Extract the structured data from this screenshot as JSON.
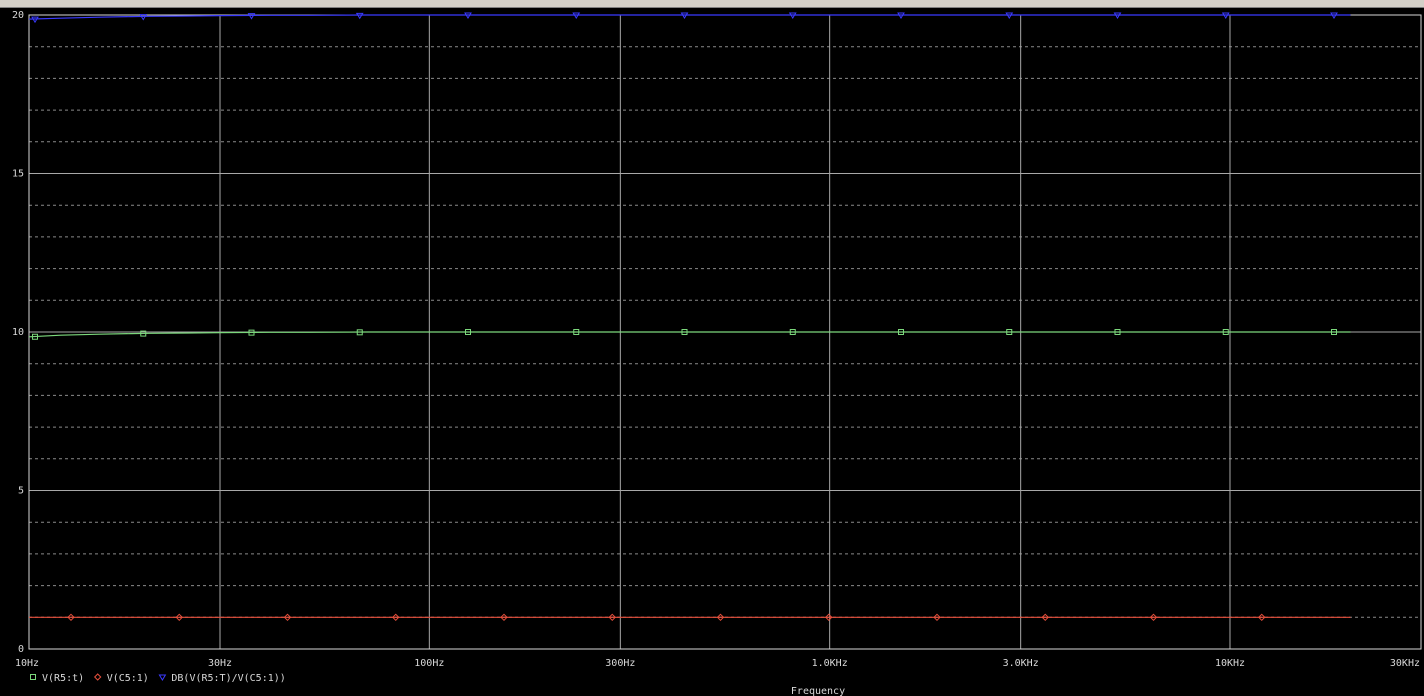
{
  "chart_data": {
    "type": "line",
    "xscale": "log",
    "xlim": [
      "10Hz",
      "30KHz"
    ],
    "ylim": [
      0,
      20
    ],
    "grid": true,
    "legend_position": "bottom-left",
    "xlabel": "Frequency",
    "ylabel": "",
    "title": "",
    "x_ticks": [
      "10Hz",
      "30Hz",
      "100Hz",
      "300Hz",
      "1.0KHz",
      "3.0KHz",
      "10KHz",
      "30KHz"
    ],
    "y_ticks": [
      "0",
      "5",
      "10",
      "15",
      "20"
    ],
    "x_values_hz": [
      10,
      12,
      15,
      18,
      20,
      25,
      30,
      40,
      50,
      70,
      100,
      150,
      200,
      300,
      500,
      700,
      1000,
      1500,
      2000,
      3000,
      5000,
      7000,
      10000,
      15000,
      20000
    ],
    "series": [
      {
        "name": "V(R5:t)",
        "color": "#7cd87c",
        "marker": "square",
        "values": [
          9.85,
          9.9,
          9.93,
          9.95,
          9.96,
          9.97,
          9.98,
          9.99,
          9.99,
          10,
          10,
          10,
          10,
          10,
          10,
          10,
          10,
          10,
          10,
          10,
          10,
          10,
          10,
          10,
          10
        ]
      },
      {
        "name": "V(C5:1)",
        "color": "#e8503c",
        "marker": "diamond",
        "values": [
          1,
          1,
          1,
          1,
          1,
          1,
          1,
          1,
          1,
          1,
          1,
          1,
          1,
          1,
          1,
          1,
          1,
          1,
          1,
          1,
          1,
          1,
          1,
          1,
          1
        ]
      },
      {
        "name": "DB(V(R5:T)/V(C5:1))",
        "color": "#3a3aff",
        "marker": "triangle-down",
        "values": [
          19.87,
          19.9,
          19.93,
          19.95,
          19.96,
          19.97,
          19.98,
          19.99,
          19.99,
          20,
          20,
          20,
          20,
          20,
          20,
          20,
          20,
          20,
          20,
          20,
          20,
          20,
          20,
          20,
          20
        ]
      }
    ]
  }
}
